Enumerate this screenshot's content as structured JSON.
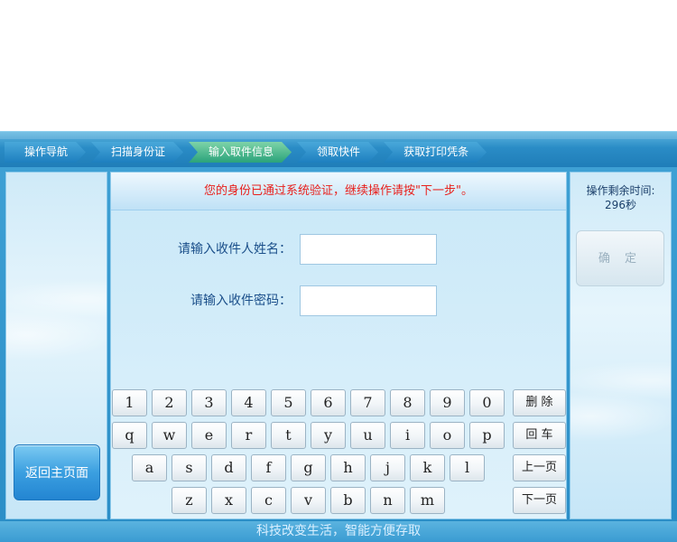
{
  "steps": [
    {
      "label": "操作导航",
      "active": false
    },
    {
      "label": "扫描身份证",
      "active": false
    },
    {
      "label": "输入取件信息",
      "active": true
    },
    {
      "label": "领取快件",
      "active": false
    },
    {
      "label": "获取打印凭条",
      "active": false
    }
  ],
  "message": "您的身份已通过系统验证，继续操作请按\"下一步\"。",
  "form": {
    "name_label": "请输入收件人姓名：",
    "name_value": "",
    "password_label": "请输入收件密码：",
    "password_value": ""
  },
  "keyboard": {
    "row1": [
      "1",
      "2",
      "3",
      "4",
      "5",
      "6",
      "7",
      "8",
      "9",
      "0"
    ],
    "row2": [
      "q",
      "w",
      "e",
      "r",
      "t",
      "y",
      "u",
      "i",
      "o",
      "p"
    ],
    "row3": [
      "a",
      "s",
      "d",
      "f",
      "g",
      "h",
      "j",
      "k",
      "l"
    ],
    "row4": [
      "z",
      "x",
      "c",
      "v",
      "b",
      "n",
      "m"
    ],
    "delete_label": "删 除",
    "enter_label": "回 车",
    "prev_label": "上一页",
    "next_label": "下一页"
  },
  "left": {
    "back_home_label": "返回主页面"
  },
  "right": {
    "timer_label": "操作剩余时间:",
    "timer_value": "296秒",
    "confirm_label": "确 定"
  },
  "footer": {
    "slogan": "科技改变生活，智能方便存取"
  },
  "colors": {
    "message_red": "#e8211d",
    "active_step": "#2aa37a",
    "step_blue": "#1d7fbf"
  }
}
